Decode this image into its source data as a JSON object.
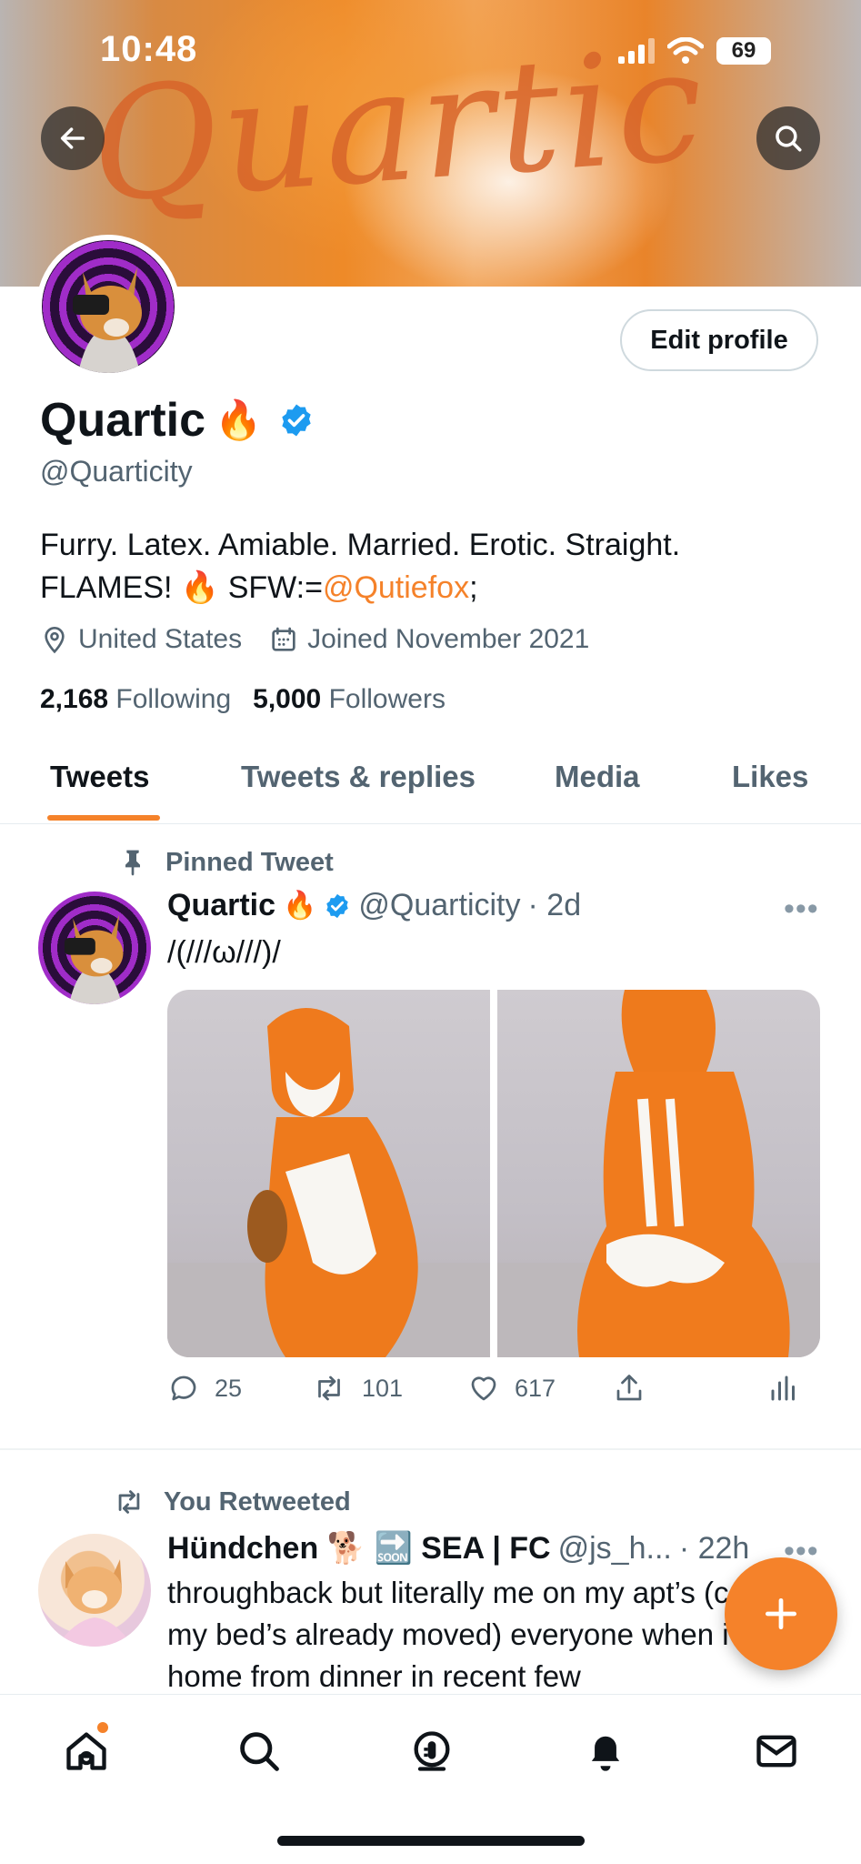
{
  "status_bar": {
    "time": "10:48",
    "battery": "69"
  },
  "banner": {
    "script_text": "Quartic"
  },
  "header": {
    "edit_profile_label": "Edit profile"
  },
  "profile": {
    "name": "Quartic",
    "name_emoji": "🔥",
    "handle": "@Quarticity",
    "bio_line1": "Furry. Latex. Amiable. Married. Erotic. Straight.",
    "bio_line2_prefix": "FLAMES! 🔥 SFW:=",
    "bio_link": "@Qutiefox",
    "bio_line2_suffix": ";",
    "location": "United States",
    "joined": "Joined November 2021",
    "following_count": "2,168",
    "following_label": "Following",
    "followers_count": "5,000",
    "followers_label": "Followers"
  },
  "tabs": [
    {
      "label": "Tweets",
      "active": true
    },
    {
      "label": "Tweets & replies",
      "active": false
    },
    {
      "label": "Media",
      "active": false
    },
    {
      "label": "Likes",
      "active": false
    }
  ],
  "pinned_tweet": {
    "context": "Pinned Tweet",
    "author_name": "Quartic",
    "author_emoji": "🔥",
    "author_handle": "@Quarticity",
    "time": "· 2d",
    "text": "/(///ω///)/",
    "replies": "25",
    "retweets": "101",
    "likes": "617"
  },
  "retweet": {
    "context": "You Retweeted",
    "author_name": "Hündchen 🐕 🔜 SEA | FC",
    "author_handle": "@js_h...",
    "time": "· 22h",
    "text": "throughback but literally me on my apt’s (cause my bed’s already moved) everyone when i got home from dinner in recent few"
  },
  "colors": {
    "accent": "#f5822a",
    "verified": "#1d9bf0",
    "muted": "#536471"
  },
  "icons": [
    "back-arrow-icon",
    "search-icon",
    "pin-icon",
    "verified-icon",
    "location-icon",
    "calendar-icon",
    "reply-icon",
    "retweet-icon",
    "like-icon",
    "share-icon",
    "analytics-icon",
    "compose-plus-icon",
    "home-icon",
    "explore-icon",
    "spaces-icon",
    "notifications-icon",
    "messages-icon"
  ]
}
